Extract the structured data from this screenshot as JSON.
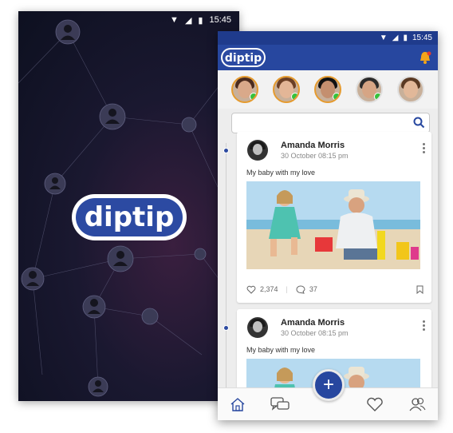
{
  "status_bar": {
    "time": "15:45"
  },
  "splash": {
    "logo_text": "diptip"
  },
  "app": {
    "logo_text": "diptip",
    "search": {
      "placeholder": "",
      "value": ""
    }
  },
  "stories": [
    {
      "name": "story-1",
      "online": true
    },
    {
      "name": "story-2",
      "online": true
    },
    {
      "name": "story-3",
      "online": true
    },
    {
      "name": "story-4",
      "online": true
    },
    {
      "name": "story-5",
      "online": false
    }
  ],
  "posts": [
    {
      "author": "Amanda Morris",
      "time": "30 October 08:15 pm",
      "text": "My baby with my love",
      "likes": "2,374",
      "comments": "37"
    },
    {
      "author": "Amanda Morris",
      "time": "30 October 08:15 pm",
      "text": "My baby with my love"
    }
  ],
  "colors": {
    "brand_blue": "#27479f",
    "story_ring": "#e59b2f",
    "online": "#37c13c"
  },
  "icons": [
    "home-icon",
    "chat-icon",
    "plus-icon",
    "heart-icon",
    "users-icon",
    "bell-icon",
    "search-icon"
  ]
}
